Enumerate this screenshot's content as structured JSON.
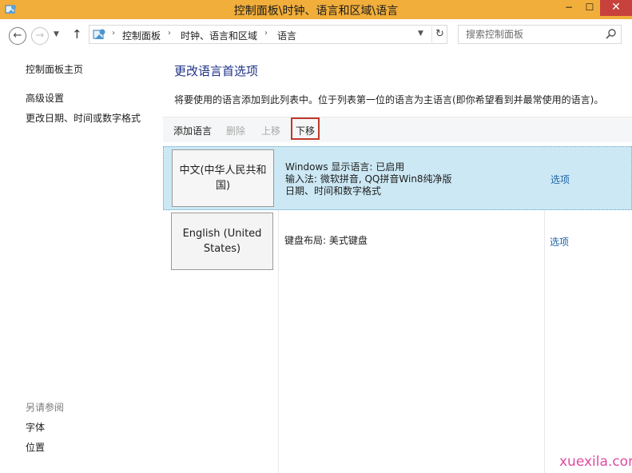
{
  "window": {
    "title": "控制面板\\时钟、语言和区域\\语言",
    "controls": {
      "minimize": "−",
      "maximize": "☐",
      "close": "✕"
    },
    "title_bar_color": "#f1ae3b"
  },
  "nav": {
    "back_glyph": "←",
    "forward_glyph": "→",
    "recent_glyph": "▼",
    "up_glyph": "↑",
    "breadcrumbs": [
      "控制面板",
      "时钟、语言和区域",
      "语言"
    ],
    "separator": "›",
    "dropdown_glyph": "▼",
    "refresh_glyph": "↻",
    "search_placeholder": "搜索控制面板"
  },
  "sidebar": {
    "links": [
      "控制面板主页",
      "高级设置",
      "更改日期、时间或数字格式"
    ],
    "see_also_heading": "另请参阅",
    "see_also": [
      "字体",
      "位置"
    ]
  },
  "main": {
    "title": "更改语言首选项",
    "description": "将要使用的语言添加到此列表中。位于列表第一位的语言为主语言(即你希望看到并最常使用的语言)。",
    "toolbar": [
      {
        "label": "添加语言",
        "enabled": true
      },
      {
        "label": "删除",
        "enabled": false
      },
      {
        "label": "上移",
        "enabled": false
      },
      {
        "label": "下移",
        "enabled": true,
        "highlighted": true
      }
    ],
    "languages": [
      {
        "name": "中文(中华人民共和国)",
        "selected": true,
        "details": [
          "Windows 显示语言: 已启用",
          "输入法: 微软拼音, QQ拼音Win8纯净版",
          "日期、时间和数字格式"
        ],
        "options_label": "选项"
      },
      {
        "name": "English (United States)",
        "selected": false,
        "details": [
          "键盘布局: 美式键盘"
        ],
        "options_label": "选项"
      }
    ]
  },
  "watermark": "xuexila.com",
  "colors": {
    "title_accent": "#1e3287",
    "link": "#1e64a8",
    "selection": "#cce8f4",
    "highlight_box": "#c0392b",
    "watermark": "#e14aa0"
  }
}
